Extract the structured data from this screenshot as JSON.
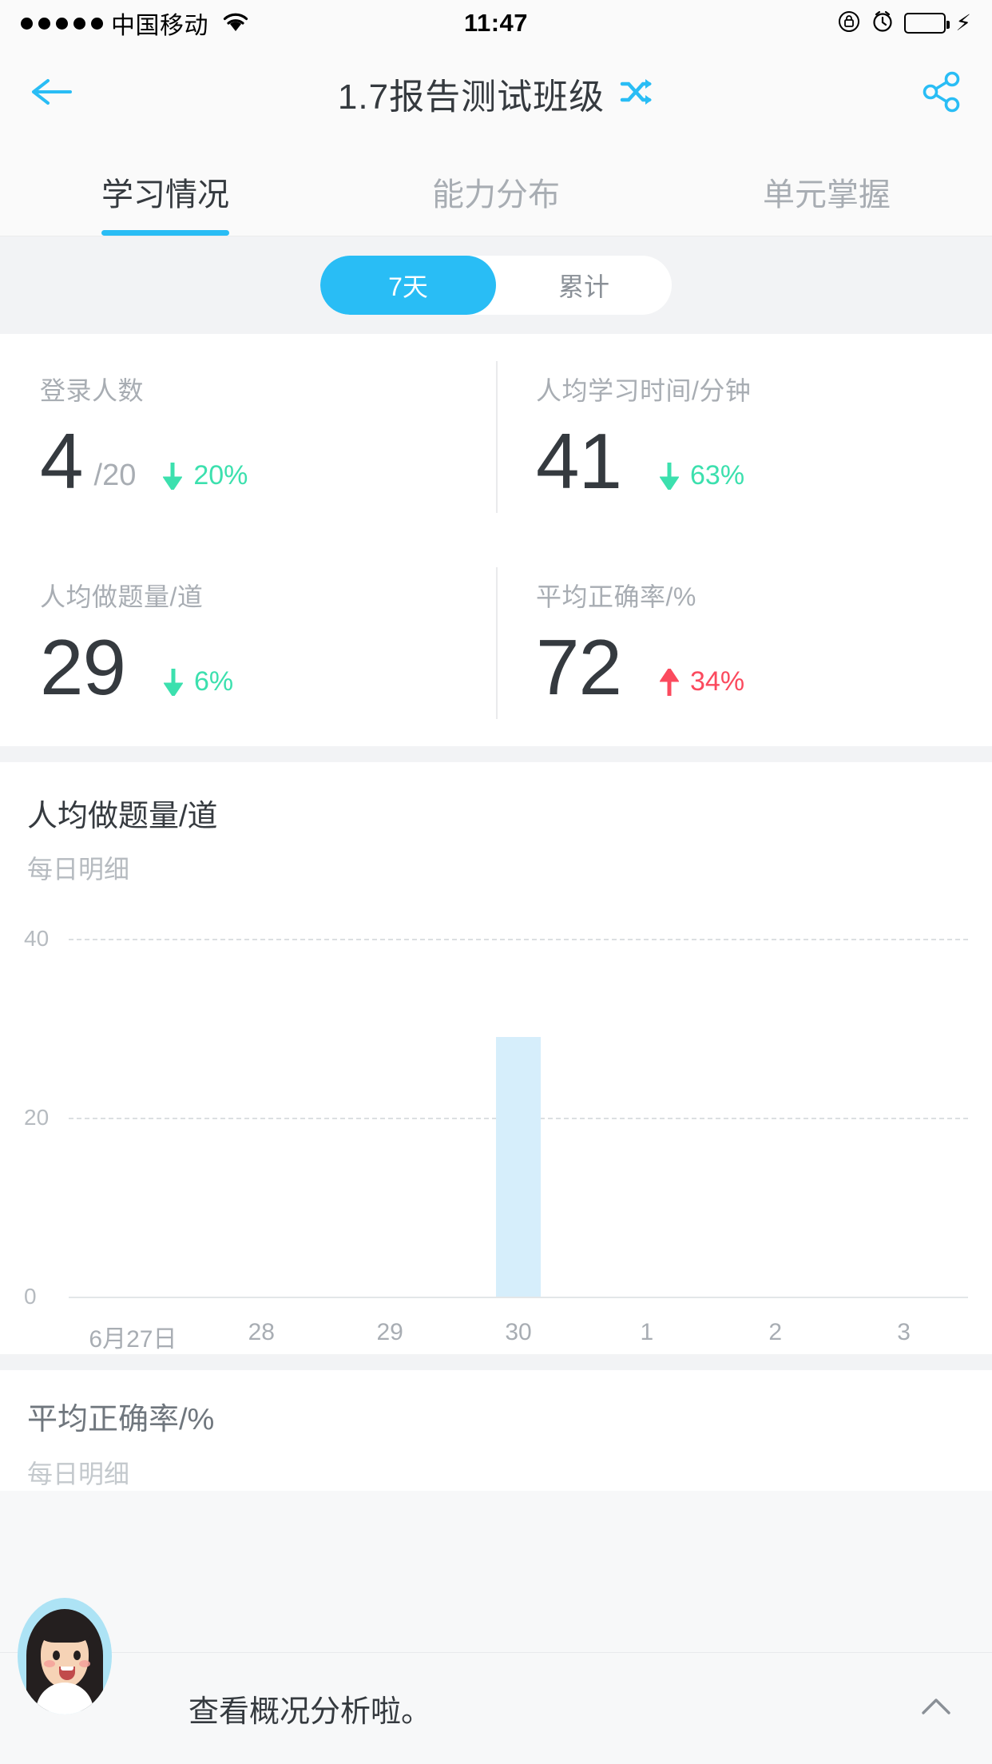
{
  "status_bar": {
    "carrier": "中国移动",
    "time": "11:47",
    "signal_dots": 5,
    "icons": [
      "wifi-icon",
      "rotation-lock-icon",
      "alarm-icon",
      "battery-icon",
      "charging-bolt-icon"
    ],
    "battery_color": "#4cd964"
  },
  "header": {
    "title": "1.7报告测试班级",
    "back_icon": "arrow-left-icon",
    "switch_icon": "shuffle-icon",
    "share_icon": "share-icon",
    "accent": "#29bdf5"
  },
  "tabs": [
    {
      "label": "学习情况",
      "active": true
    },
    {
      "label": "能力分布",
      "active": false
    },
    {
      "label": "单元掌握",
      "active": false
    }
  ],
  "range_toggle": {
    "options": [
      {
        "label": "7天",
        "active": true
      },
      {
        "label": "累计",
        "active": false
      }
    ]
  },
  "stats": [
    {
      "label": "登录人数",
      "value": "4",
      "suffix": "/20",
      "delta": "20%",
      "direction": "down",
      "color": "#3ce0ae"
    },
    {
      "label": "人均学习时间/分钟",
      "value": "41",
      "suffix": "",
      "delta": "63%",
      "direction": "down",
      "color": "#3ce0ae"
    },
    {
      "label": "人均做题量/道",
      "value": "29",
      "suffix": "",
      "delta": "6%",
      "direction": "down",
      "color": "#3ce0ae"
    },
    {
      "label": "平均正确率/%",
      "value": "72",
      "suffix": "",
      "delta": "34%",
      "direction": "up",
      "color": "#fb4a5e"
    }
  ],
  "chart_section": {
    "title": "人均做题量/道",
    "subtitle": "每日明细"
  },
  "chart_data": {
    "type": "bar",
    "title": "人均做题量/道",
    "subtitle": "每日明细",
    "xlabel": "",
    "ylabel": "",
    "categories": [
      "6月27日",
      "28",
      "29",
      "30",
      "1",
      "2",
      "3"
    ],
    "values": [
      0,
      0,
      0,
      29,
      0,
      0,
      0
    ],
    "yticks": [
      0,
      20,
      40
    ],
    "ylim": [
      0,
      40
    ],
    "grid": true,
    "bar_color": "#d6eefb",
    "legend": "none"
  },
  "next_section": {
    "title": "平均正确率/%",
    "subtitle": "每日明细"
  },
  "assistant_bar": {
    "message": "查看概况分析啦。",
    "avatar_icon": "assistant-avatar",
    "collapse_icon": "chevron-up-icon"
  }
}
